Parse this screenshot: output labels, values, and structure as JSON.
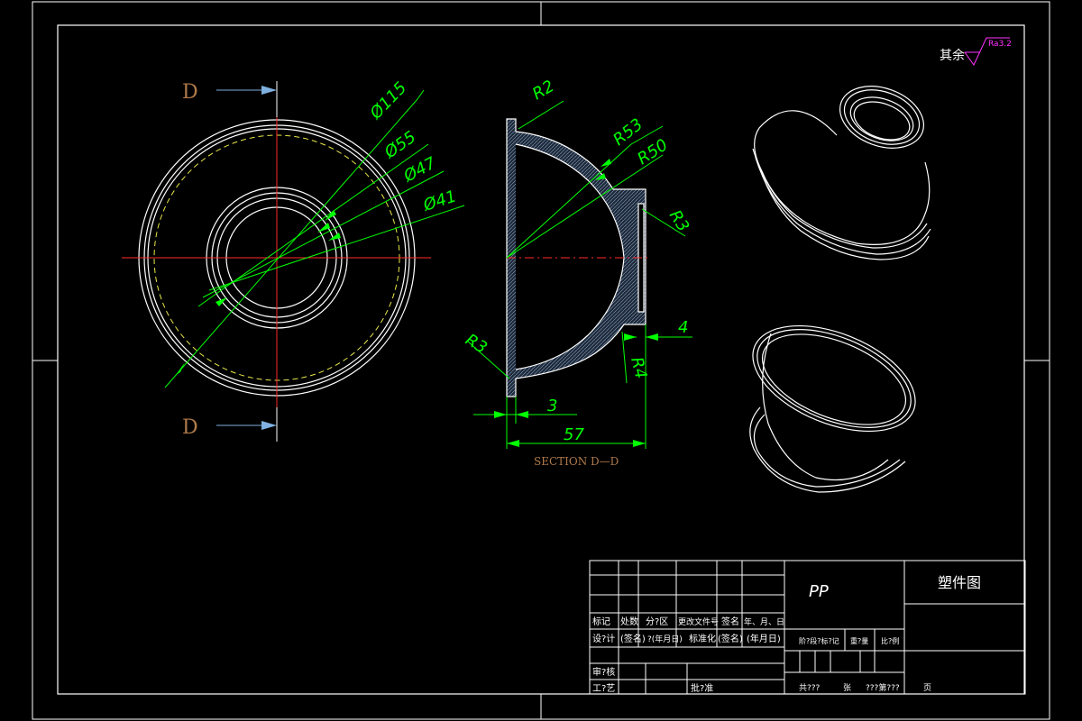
{
  "surface_roughness": {
    "label": "其余",
    "value": "Ra3.2"
  },
  "section_marks": {
    "top": "D",
    "bottom": "D"
  },
  "section_title": "SECTION D—D",
  "dimensions": {
    "d115": "Ø115",
    "d55": "Ø55",
    "d47": "Ø47",
    "d41": "Ø41",
    "r2": "R2",
    "r53": "R53",
    "r50": "R50",
    "r3_right": "R3",
    "r3_left": "R3",
    "r4": "R4",
    "w4": "4",
    "w3": "3",
    "w57": "57"
  },
  "title_block": {
    "material": "PP",
    "drawing_name": "塑件图",
    "h_mark": "标记",
    "h_count": "处数",
    "h_zone": "分?区",
    "h_doc": "更改文件号",
    "h_sign": "签名",
    "h_date": "年、月、日",
    "design": "设?计",
    "signed": "(签名)",
    "date1": "?(年月日)",
    "standard": "标准化",
    "signed2": "(签名)",
    "date2": "(年月日)",
    "stage": "阶?段?标?记",
    "weight": "重?量",
    "scale": "比?例",
    "review": "审?核",
    "process": "工?艺",
    "approve": "批?准",
    "total": "共???",
    "sheet": "张",
    "sheet_no": "???第???",
    "page": "页"
  }
}
